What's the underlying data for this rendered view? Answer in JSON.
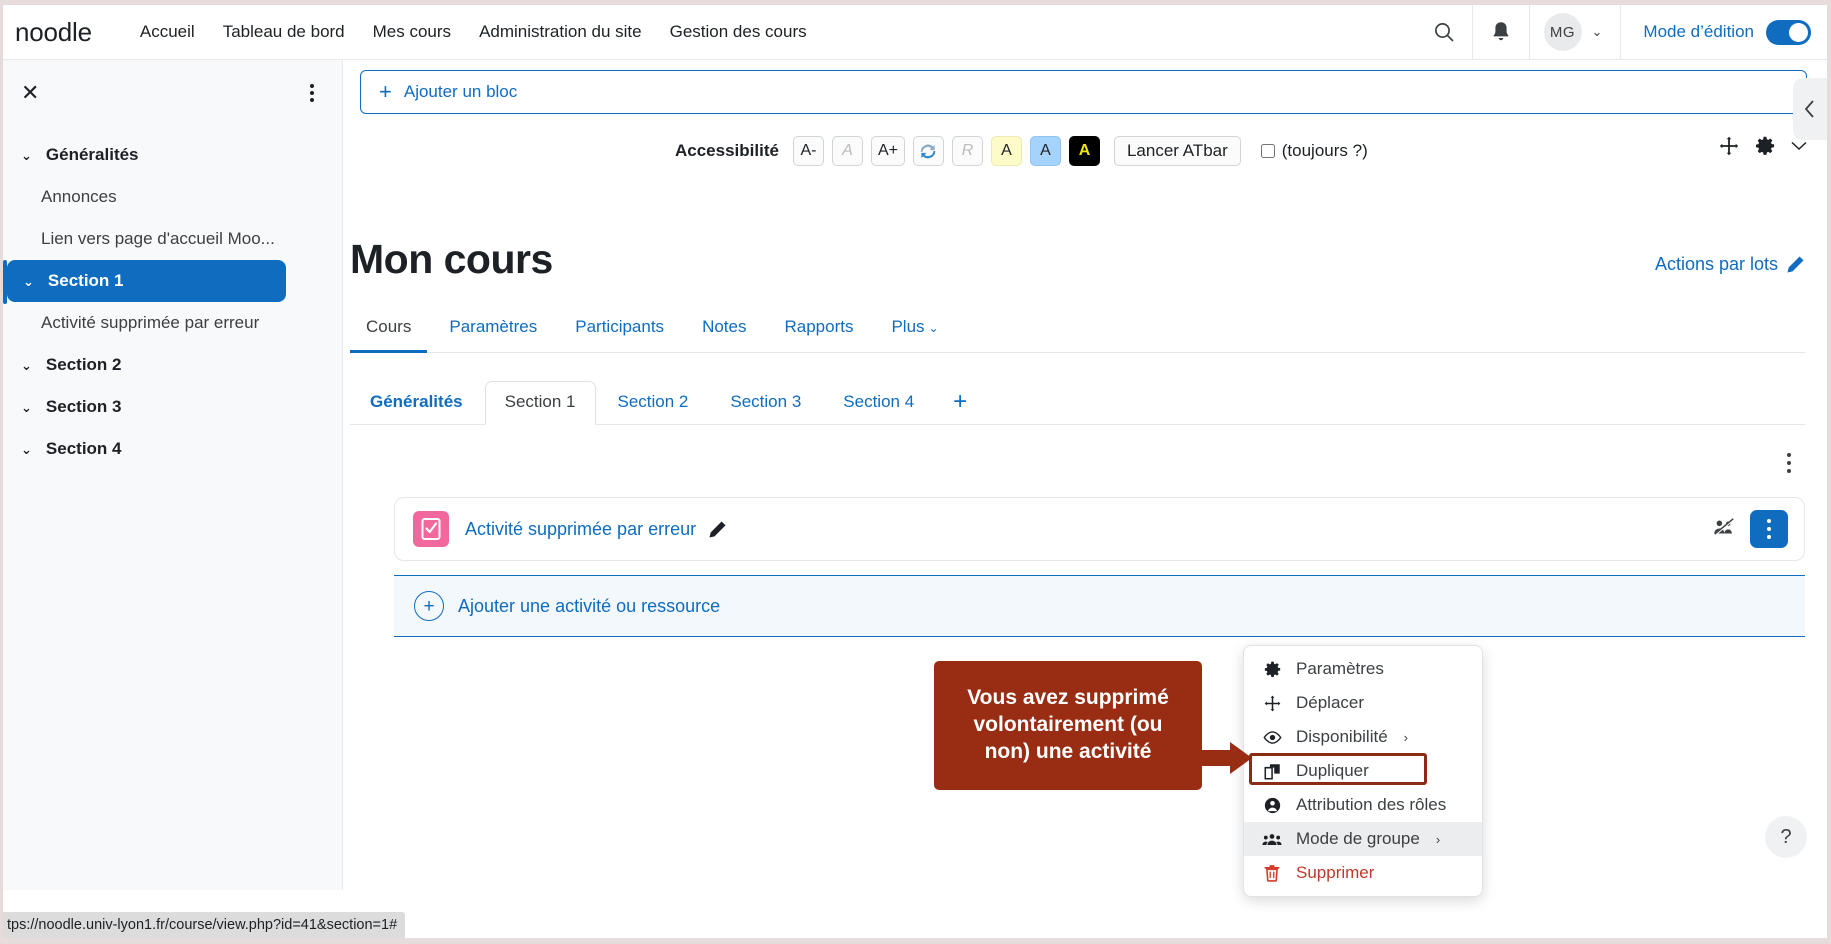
{
  "header": {
    "brand": "noodle",
    "nav": [
      {
        "label": "Accueil"
      },
      {
        "label": "Tableau de bord"
      },
      {
        "label": "Mes cours"
      },
      {
        "label": "Administration du site"
      },
      {
        "label": "Gestion des cours"
      }
    ],
    "search_icon": "search-icon",
    "notification_icon": "bell-icon",
    "avatar_initials": "MG",
    "avatar_caret": "⌄",
    "edit_mode_label": "Mode d’édition",
    "edit_mode_on": true
  },
  "sidebar": {
    "close_label": "✕",
    "sections": [
      {
        "label": "Généralités",
        "caret": "⌄",
        "active": false,
        "items": [
          {
            "label": "Annonces"
          },
          {
            "label": "Lien vers page d'accueil Moo..."
          }
        ]
      },
      {
        "label": "Section 1",
        "caret": "⌄",
        "active": true,
        "items": [
          {
            "label": "Activité supprimée par erreur"
          }
        ]
      },
      {
        "label": "Section 2",
        "caret": "⌄",
        "active": false,
        "items": []
      },
      {
        "label": "Section 3",
        "caret": "⌄",
        "active": false,
        "items": []
      },
      {
        "label": "Section 4",
        "caret": "⌄",
        "active": false,
        "items": []
      }
    ]
  },
  "add_block": {
    "label": "Ajouter un bloc",
    "plus": "+"
  },
  "accessibility": {
    "label": "Accessibilité",
    "buttons": [
      {
        "label": "A-",
        "style": "normal",
        "name": "decrease-font-button"
      },
      {
        "label": "A",
        "style": "disabled",
        "name": "reset-font-button"
      },
      {
        "label": "A+",
        "style": "normal",
        "name": "increase-font-button"
      },
      {
        "label": "",
        "style": "image",
        "name": "refresh-icon"
      },
      {
        "label": "R",
        "style": "disabled",
        "name": "reset-styles-button"
      },
      {
        "label": "A",
        "style": "yellow",
        "name": "yellow-contrast-button"
      },
      {
        "label": "A",
        "style": "blue",
        "name": "blue-contrast-button"
      },
      {
        "label": "A",
        "style": "black",
        "name": "black-contrast-button"
      }
    ],
    "launch_label": "Lancer ATbar",
    "always_label": "(toujours ?)",
    "always_checked": false
  },
  "block_controls": {
    "move_icon": "move-icon",
    "gear_icon": "gear-icon",
    "caret_icon": "chevron-down-icon"
  },
  "course": {
    "title": "Mon cours",
    "bulk_actions_label": "Actions par lots",
    "bulk_actions_icon": "pencil-icon",
    "primary_tabs": [
      {
        "label": "Cours",
        "active": true
      },
      {
        "label": "Paramètres",
        "active": false
      },
      {
        "label": "Participants",
        "active": false
      },
      {
        "label": "Notes",
        "active": false
      },
      {
        "label": "Rapports",
        "active": false
      },
      {
        "label": "Plus",
        "active": false,
        "caret": "⌄"
      }
    ],
    "section_tabs": [
      {
        "label": "Généralités",
        "current": false,
        "bold": true
      },
      {
        "label": "Section 1",
        "current": true,
        "bold": false
      },
      {
        "label": "Section 2",
        "current": false,
        "bold": false
      },
      {
        "label": "Section 3",
        "current": false,
        "bold": false
      },
      {
        "label": "Section 4",
        "current": false,
        "bold": false
      }
    ],
    "add_section_label": "+"
  },
  "activity": {
    "icon_name": "assignment-icon",
    "icon_color": "#f2689e",
    "name": "Activité supprimée par erreur",
    "pencil_icon": "pencil-icon",
    "hidden_group_icon": "no-groups-icon",
    "kebab_icon": "kebab-menu-icon"
  },
  "add_activity": {
    "label": "Ajouter une activité ou ressource",
    "plus": "+"
  },
  "dropdown": {
    "items": [
      {
        "label": "Paramètres",
        "icon": "gear-icon",
        "submenu": false,
        "state": "normal"
      },
      {
        "label": "Déplacer",
        "icon": "move-icon",
        "submenu": false,
        "state": "normal"
      },
      {
        "label": "Disponibilité",
        "icon": "eye-icon",
        "submenu": true,
        "state": "normal"
      },
      {
        "label": "Dupliquer",
        "icon": "duplicate-icon",
        "submenu": false,
        "state": "normal"
      },
      {
        "label": "Attribution des rôles",
        "icon": "user-circle-icon",
        "submenu": false,
        "state": "normal"
      },
      {
        "label": "Mode de groupe",
        "icon": "groups-icon",
        "submenu": true,
        "state": "hover"
      },
      {
        "label": "Supprimer",
        "icon": "trash-icon",
        "submenu": false,
        "state": "danger"
      }
    ],
    "submenu_arrow": "›"
  },
  "callout": {
    "text": "Vous avez supprimé\nvolontairement (ou\nnon) une activité",
    "background": "#992d13",
    "text_color": "#ffffff"
  },
  "help": {
    "label": "?"
  },
  "status_bar": {
    "url": "tps://noodle.univ-lyon1.fr/course/view.php?id=41&section=1#"
  }
}
